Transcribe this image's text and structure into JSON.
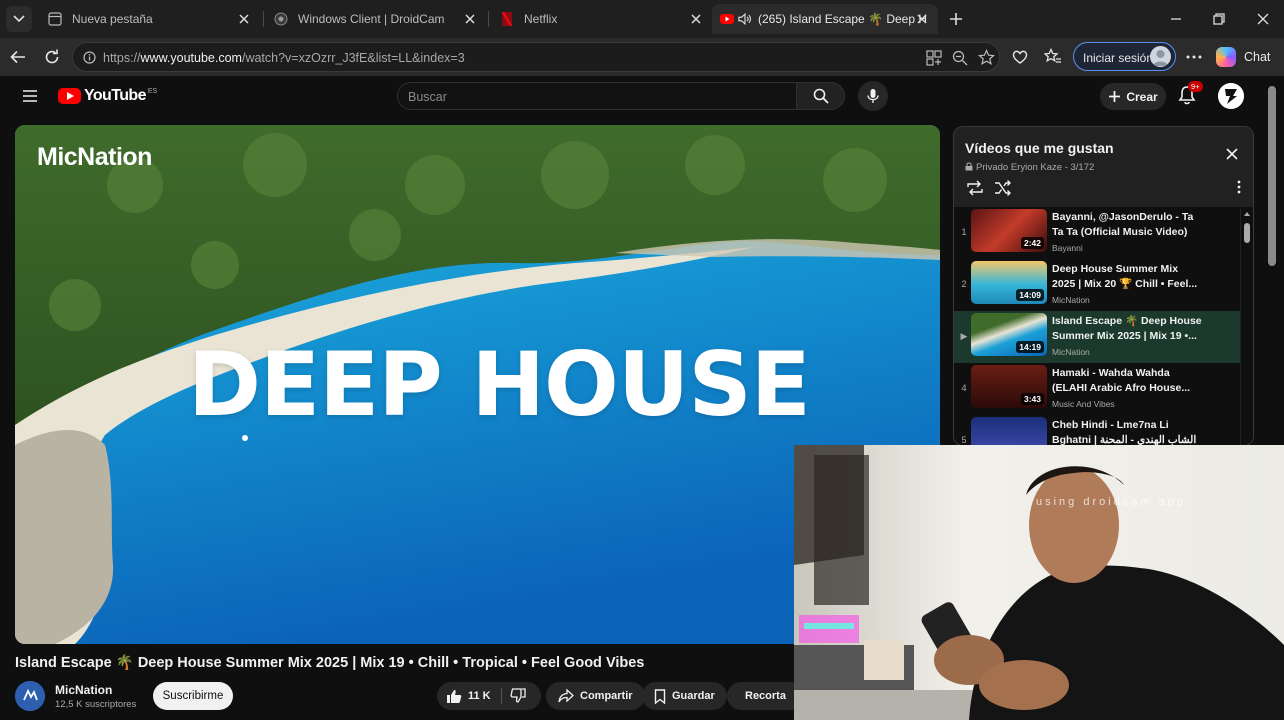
{
  "browser": {
    "tabs": [
      {
        "title": "Nueva pestaña"
      },
      {
        "title": "Windows Client | DroidCam"
      },
      {
        "title": "Netflix"
      },
      {
        "title": "(265) Island Escape 🌴 Deep H"
      }
    ],
    "url_prefix": "https://",
    "url_host": "www.youtube.com",
    "url_path": "/watch?v=xzOzrr_J3fE&list=LL&index=3",
    "signin_label": "Iniciar sesión",
    "chat_label": "Chat"
  },
  "youtube": {
    "logo_text": "YouTube",
    "region": "ES",
    "search_placeholder": "Buscar",
    "create_label": "Crear",
    "notif_badge": "9+"
  },
  "video": {
    "channel_watermark": "MicNation",
    "overlay_title": "DEEP HOUSE",
    "title": "Island Escape 🌴 Deep House Summer Mix 2025 | Mix 19 • Chill • Tropical • Feel Good Vibes",
    "channel": "MicNation",
    "subscribers": "12,5 K suscriptores",
    "subscribe_label": "Suscribirme",
    "likes": "11 K",
    "share_label": "Compartir",
    "save_label": "Guardar",
    "clip_label": "Recorta"
  },
  "playlist": {
    "title": "Vídeos que me gustan",
    "subtitle": "Privado Eryion Kaze - 3/172",
    "items": [
      {
        "index": "1",
        "title": "Bayanni, @JasonDerulo - Ta Ta Ta (Official Music Video)",
        "channel": "Bayanni",
        "duration": "2:42"
      },
      {
        "index": "2",
        "title": "Deep House Summer Mix 2025 | Mix 20 🏆 Chill • Feel...",
        "channel": "MicNation",
        "duration": "14:09"
      },
      {
        "index": "▶",
        "title": "Island Escape 🌴 Deep House Summer Mix 2025 | Mix 19 •...",
        "channel": "MicNation",
        "duration": "14:19"
      },
      {
        "index": "4",
        "title": "Hamaki - Wahda Wahda (ELAHI Arabic Afro House...",
        "channel": "Music And Vibes",
        "duration": "3:43"
      },
      {
        "index": "5",
        "title": "Cheb Hindi - Lme7na Li Bghatni | الشاب الهندي - المحنة لي",
        "channel": "",
        "duration": ""
      }
    ]
  },
  "webcam": {
    "watermark": "using droidcam app"
  }
}
